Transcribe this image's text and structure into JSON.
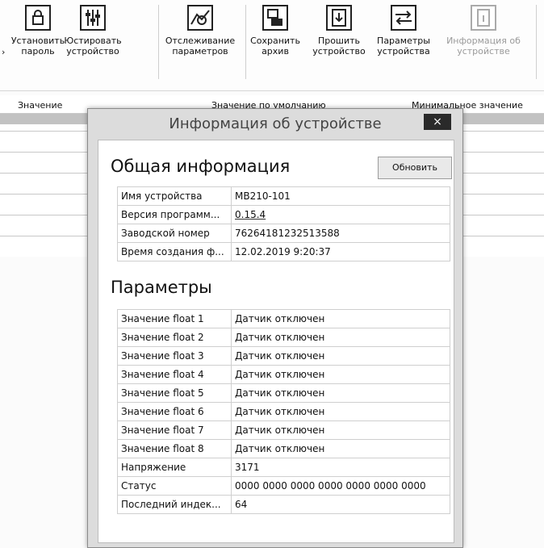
{
  "toolbar": {
    "lead": "›",
    "buttons": [
      {
        "icon": "lock-icon",
        "line1": "Установить",
        "line2": "пароль"
      },
      {
        "icon": "sliders-icon",
        "line1": "Юстировать",
        "line2": "устройство"
      },
      {
        "icon": "chart-tracking-icon",
        "line1": "Отслеживание",
        "line2": "параметров"
      },
      {
        "icon": "save-archive-icon",
        "line1": "Сохранить",
        "line2": "архив"
      },
      {
        "icon": "firmware-icon",
        "line1": "Прошить",
        "line2": "устройство"
      },
      {
        "icon": "device-params-icon",
        "line1": "Параметры",
        "line2": "устройства"
      },
      {
        "icon": "device-info-icon",
        "line1": "Информация об",
        "line2": "устройстве"
      }
    ]
  },
  "grid": {
    "columns": [
      "Значение",
      "Значение по умолчанию",
      "Минимальное значение"
    ]
  },
  "dialog": {
    "title": "Информация об устройстве",
    "close_label": "×",
    "general": {
      "title": "Общая информация",
      "refresh_label": "Обновить",
      "rows": [
        {
          "key": "Имя устройства",
          "value": "МВ210-101"
        },
        {
          "key": "Версия программ...",
          "value": "0.15.4"
        },
        {
          "key": "Заводской номер",
          "value": "76264181232513588"
        },
        {
          "key": "Время создания ф...",
          "value": "12.02.2019 9:20:37"
        }
      ]
    },
    "params": {
      "title": "Параметры",
      "rows": [
        {
          "key": "Значение float 1",
          "value": "Датчик отключен"
        },
        {
          "key": "Значение float 2",
          "value": "Датчик отключен"
        },
        {
          "key": "Значение float 3",
          "value": "Датчик отключен"
        },
        {
          "key": "Значение float 4",
          "value": "Датчик отключен"
        },
        {
          "key": "Значение float 5",
          "value": "Датчик отключен"
        },
        {
          "key": "Значение float 6",
          "value": "Датчик отключен"
        },
        {
          "key": "Значение float 7",
          "value": "Датчик отключен"
        },
        {
          "key": "Значение float 8",
          "value": "Датчик отключен"
        },
        {
          "key": "Напряжение",
          "value": "3171"
        },
        {
          "key": "Статус",
          "value": "0000 0000 0000 0000 0000 0000 0000"
        },
        {
          "key": "Последний индек...",
          "value": "64"
        }
      ]
    }
  }
}
